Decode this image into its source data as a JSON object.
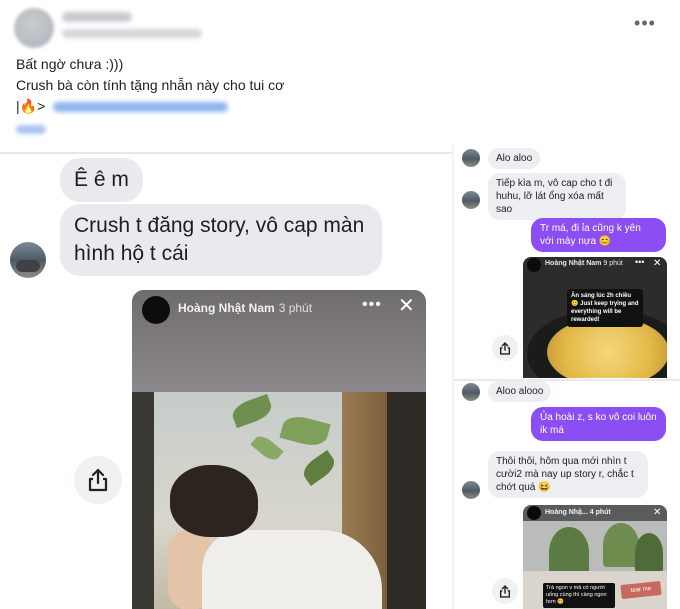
{
  "post": {
    "more_label": "•••",
    "lines": [
      "Bất ngờ chưa :)))",
      "Crush bà còn tính tặng nhẫn này cho tui cơ",
      "|🔥>"
    ]
  },
  "left_chat": {
    "messages": [
      "Ê ê m",
      "Crush t đăng story, vô cap màn hình hộ t cái"
    ],
    "story": {
      "name": "Hoàng Nhật Nam",
      "time": "3 phút",
      "more": "•••",
      "close": "✕"
    }
  },
  "right_chat": {
    "messages": [
      {
        "side": "in",
        "text": "Alo aloo"
      },
      {
        "side": "in",
        "text": "Tiếp kìa m, vô cap cho t đi huhu, lỡ lát ổng xóa mất sao"
      },
      {
        "side": "out",
        "text": "Tr má, đi ỉa cũng k yên với mày nựa 😊"
      },
      {
        "side": "in",
        "text": "Aloo alooo"
      },
      {
        "side": "out",
        "text": "Ủa hoài z, s ko vô coi luôn ik má"
      },
      {
        "side": "in",
        "text": "Thôi thôi, hôm qua mới nhìn t cười2 mà nay up story r, chắc t chớt quá 😆"
      }
    ],
    "story1": {
      "name": "Hoàng Nhật Nam",
      "time": "9 phút",
      "sticker": "Ăn sáng lúc 2h chiều 🙂 Just keep trying and everything will be rewarded!"
    },
    "story2": {
      "name": "Hoàng Nhậ...",
      "time": "4 phút",
      "caption": "Trà ngon v mà có người uống cùng thì càng ngon hơn 😊",
      "sticker": "tear me"
    }
  },
  "colors": {
    "outgoing": "#8a4ef2",
    "incoming": "#eceef1"
  },
  "icons": [
    "more-icon",
    "share-icon",
    "close-icon"
  ]
}
